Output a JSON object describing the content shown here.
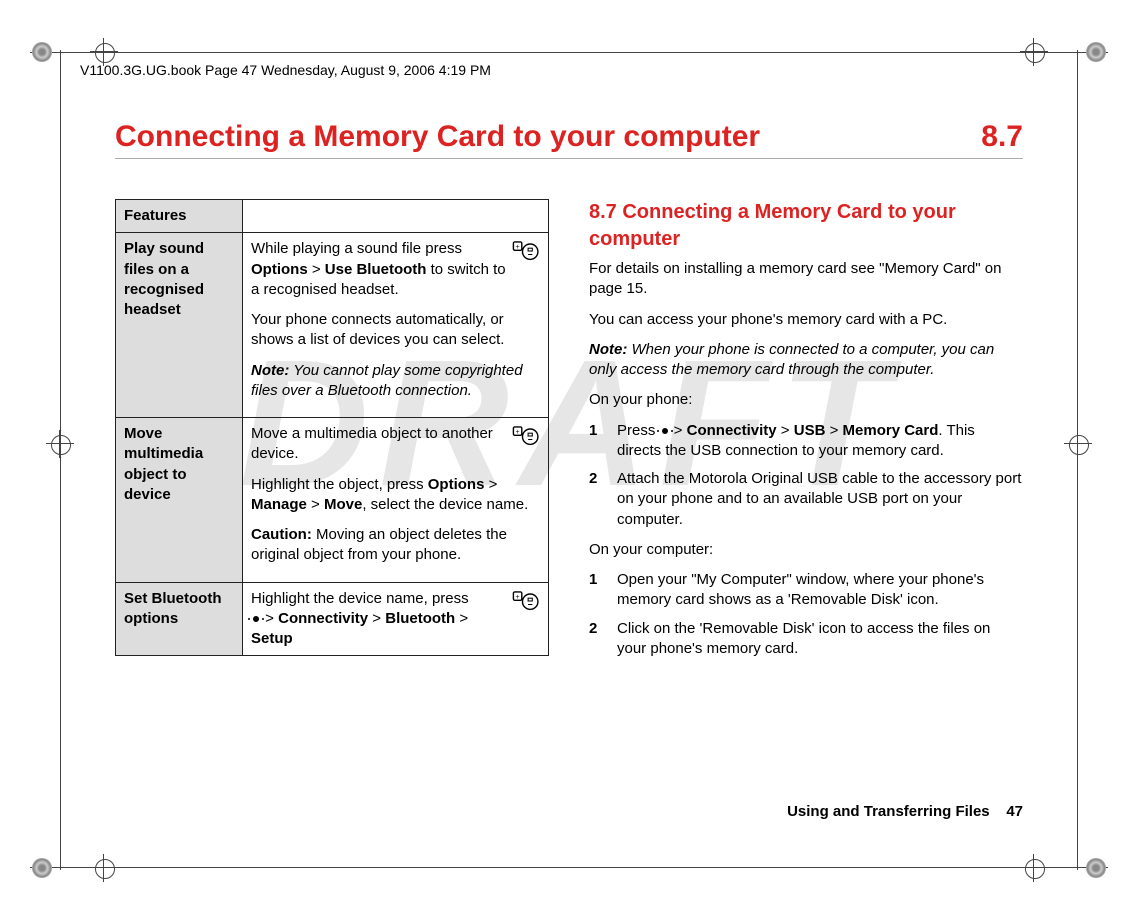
{
  "header_meta": "V1100.3G.UG.book  Page 47  Wednesday, August 9, 2006  4:19 PM",
  "watermark": "DRAFT",
  "title": "Connecting a Memory Card to your computer",
  "section_number": "8.7",
  "features_header": "Features",
  "features": [
    {
      "name": "Play sound files on a recognised headset",
      "line1_pre": "While playing a sound file press ",
      "line1_path1": "Options",
      "line1_gt": " > ",
      "line1_path2": "Use Bluetooth",
      "line1_post": " to switch to a recognised headset.",
      "line2": "Your phone connects automatically, or shows a list of devices you can select.",
      "note_label": "Note:",
      "note_text": " You cannot play some copyrighted files over a Bluetooth connection."
    },
    {
      "name": "Move multimedia object to device",
      "line1": "Move a multimedia object to another device.",
      "line2_pre": "Highlight the object, press ",
      "line2_p1": "Options",
      "line2_gt1": " > ",
      "line2_p2": "Manage",
      "line2_gt2": " > ",
      "line2_p3": "Move",
      "line2_post": ", select the device name.",
      "caution_label": "Caution:",
      "caution_text": " Moving an object deletes the original object from your phone."
    },
    {
      "name": "Set Bluetooth options",
      "line1": "Highlight the device name, press",
      "path_gt1": " > ",
      "path_p1": "Connectivity",
      "path_gt2": " > ",
      "path_p2": "Bluetooth",
      "path_gt3": " > ",
      "path_p3": "Setup"
    }
  ],
  "right": {
    "heading": "8.7 Connecting a Memory Card to your computer",
    "p1": "For details on installing a memory card see \"Memory Card\" on page 15.",
    "p2": "You can access your phone's memory card with a PC.",
    "note_label": "Note:",
    "note_text": " When your phone is connected to a computer, you can only access the memory card through the computer.",
    "on_phone": "On your phone:",
    "phone_steps": [
      {
        "num": "1",
        "pre": "Press ",
        "gt1": " > ",
        "p1": "Connectivity",
        "gt2": " > ",
        "p2": "USB",
        "gt3": " > ",
        "p3": "Memory Card",
        "post": ". This directs the USB connection to your memory card."
      },
      {
        "num": "2",
        "text": "Attach the Motorola Original USB cable to the accessory port on your phone and to an available USB port on your computer."
      }
    ],
    "on_computer": "On your computer:",
    "computer_steps": [
      {
        "num": "1",
        "text": "Open your \"My Computer\" window, where your phone's memory card shows as a 'Removable Disk' icon."
      },
      {
        "num": "2",
        "text": "Click on the 'Removable Disk' icon to access the files on your phone's memory card."
      }
    ]
  },
  "footer": {
    "chapter": "Using and Transferring Files",
    "page": "47"
  }
}
